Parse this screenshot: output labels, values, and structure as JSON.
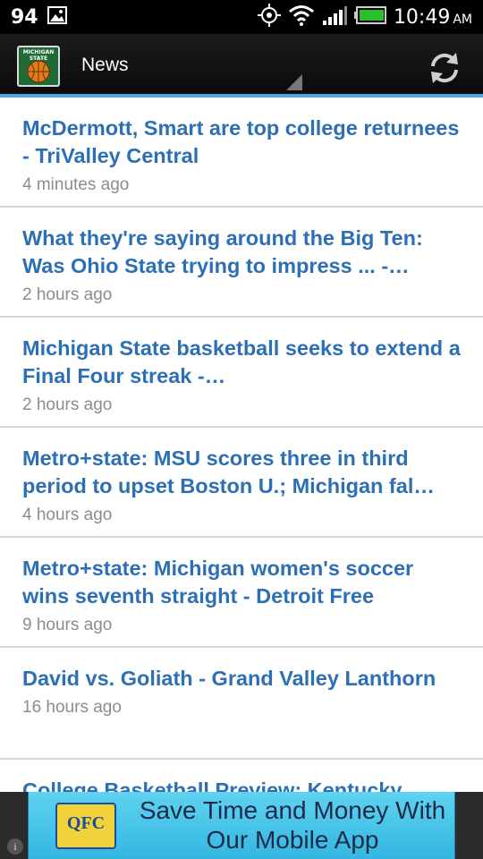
{
  "status_bar": {
    "notification_count": "94",
    "time": "10:49",
    "ampm": "AM",
    "icons": [
      "image-icon",
      "gps-icon",
      "wifi-icon",
      "signal-icon",
      "battery-icon"
    ]
  },
  "app_bar": {
    "logo_text": "MICHIGAN STATE",
    "title": "News",
    "accent_color": "#4aa6e0"
  },
  "news": [
    {
      "title": "McDermott, Smart are top college returnees - TriValley Central",
      "time": "4 minutes ago"
    },
    {
      "title": "What they're saying around the Big Ten: Was Ohio State trying to impress ... -…",
      "time": "2 hours ago"
    },
    {
      "title": "Michigan State basketball seeks to extend a Final Four streak -…",
      "time": "2 hours ago"
    },
    {
      "title": "Metro+state: MSU scores three in third period to upset Boston U.; Michigan fal…",
      "time": "4 hours ago"
    },
    {
      "title": "Metro+state: Michigan women's soccer wins seventh straight - Detroit Free",
      "time": "9 hours ago"
    },
    {
      "title": "David vs. Goliath - Grand Valley Lanthorn",
      "time": "16 hours ago"
    },
    {
      "title": "College Basketball Preview: Kentucky",
      "time": ""
    }
  ],
  "ad": {
    "logo_text": "QFC",
    "text": "Save Time and Money With Our Mobile App",
    "info_icon": "i"
  }
}
